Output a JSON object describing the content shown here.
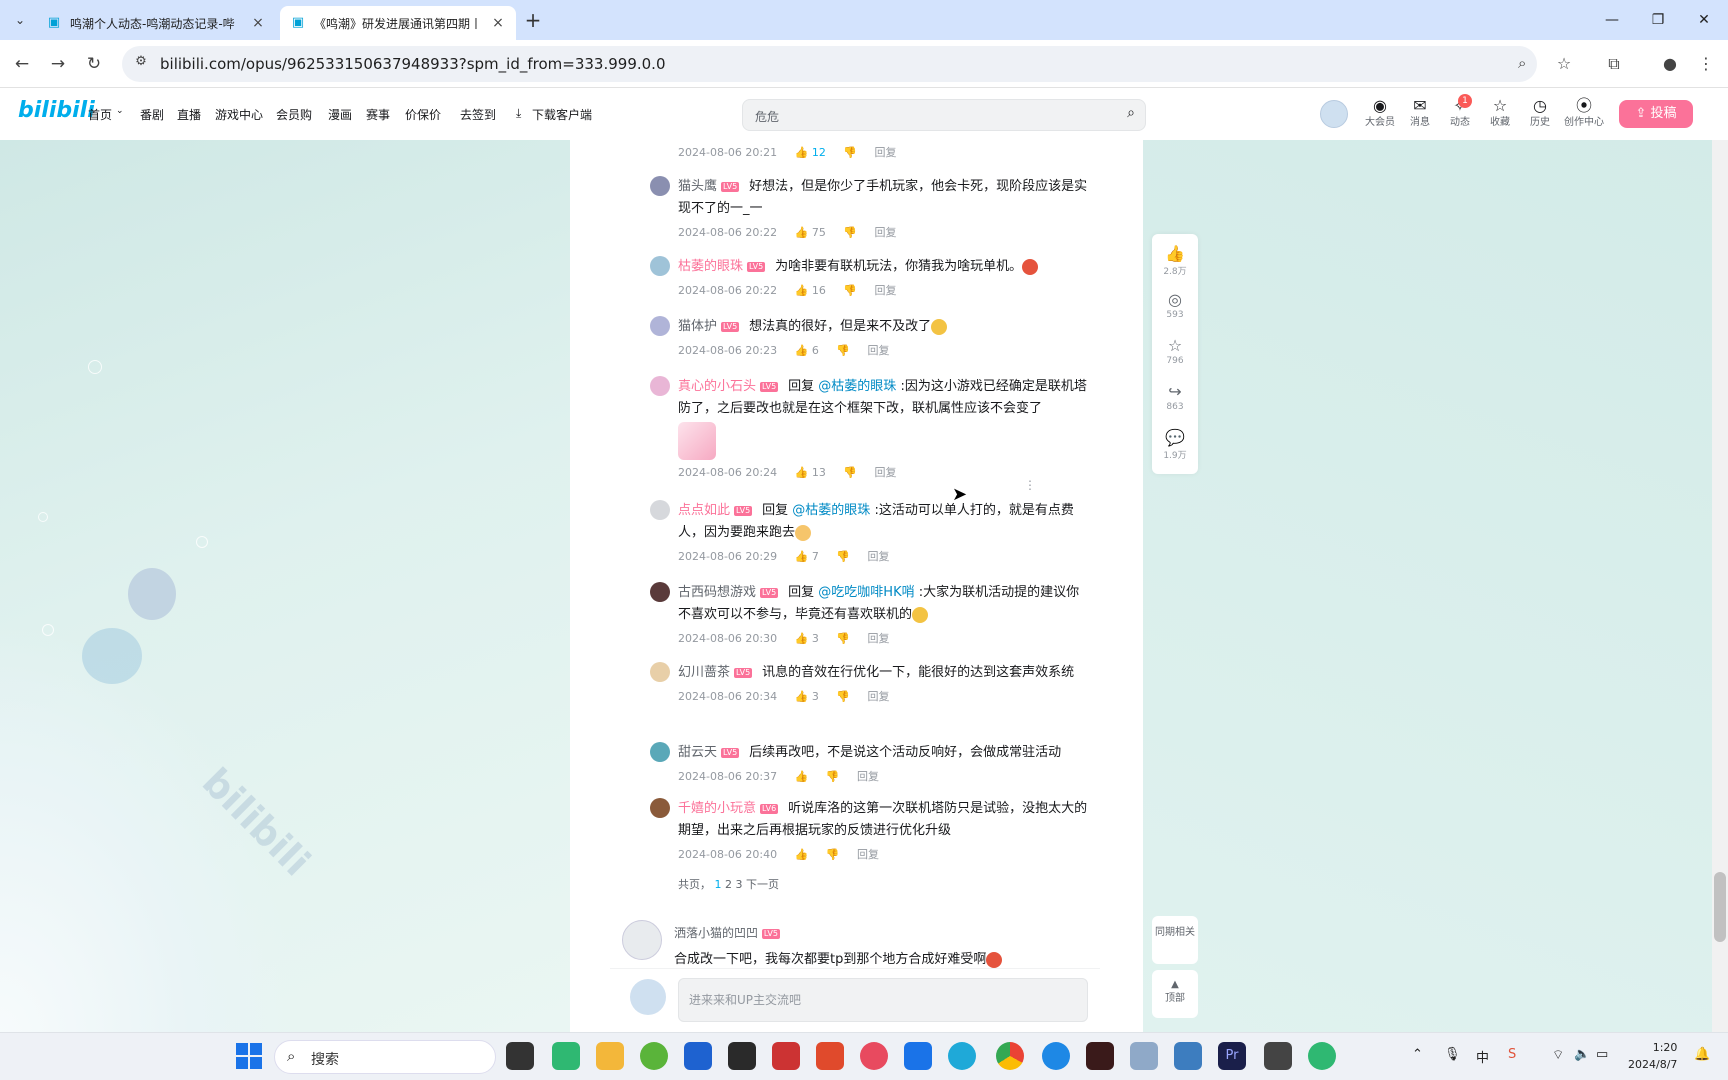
{
  "browser": {
    "tabs": [
      {
        "title": "鸣潮个人动态-鸣潮动态记录-哔"
      },
      {
        "title": "《鸣潮》研发进展通讯第四期丨"
      }
    ],
    "url": "bilibili.com/opus/962533150637948933?spm_id_from=333.999.0.0"
  },
  "header": {
    "logo": "bilibili",
    "nav": [
      "首页",
      "番剧",
      "直播",
      "游戏中心",
      "会员购",
      "漫画",
      "赛事",
      "价保价",
      "去签到",
      "下载客户端"
    ],
    "search_placeholder": "危危",
    "icons": [
      {
        "name": "大会员",
        "glyph": "◉"
      },
      {
        "name": "消息",
        "glyph": "✉"
      },
      {
        "name": "动态",
        "glyph": "✧"
      },
      {
        "name": "收藏",
        "glyph": "☆"
      },
      {
        "name": "历史",
        "glyph": "◷"
      },
      {
        "name": "创作中心",
        "glyph": "⦿"
      }
    ],
    "badge": "1",
    "upload": "投稿"
  },
  "replies": [
    {
      "meta": {
        "date": "2024-08-06 20:21",
        "likes": "12",
        "reply": "回复"
      }
    },
    {
      "user": "猫头鹰",
      "level": "LV5",
      "text": "好想法，但是你少了手机玩家，他会卡死，现阶段应该是实现不了的一_一",
      "meta": {
        "date": "2024-08-06 20:22",
        "likes": "75",
        "reply": "回复"
      }
    },
    {
      "user": "枯萎的眼珠",
      "level": "LV5",
      "pink": true,
      "text": "为啥非要有联机玩法，你猜我为啥玩单机。",
      "meta": {
        "date": "2024-08-06 20:22",
        "likes": "16",
        "reply": "回复"
      }
    },
    {
      "user": "猫体护",
      "level": "LV5",
      "text": "想法真的很好，但是来不及改了",
      "meta": {
        "date": "2024-08-06 20:23",
        "likes": "6",
        "reply": "回复"
      }
    },
    {
      "user": "真心的小石头",
      "level": "LV5",
      "pink": true,
      "prefix": "回复 ",
      "at": "@枯萎的眼珠",
      "text": " :因为这小游戏已经确定是联机塔防了，之后要改也就是在这个框架下改，联机属性应该不会变了",
      "meta": {
        "date": "2024-08-06 20:24",
        "likes": "13",
        "reply": "回复"
      }
    },
    {
      "user": "点点如此",
      "level": "LV5",
      "pink": true,
      "prefix": "回复 ",
      "at": "@枯萎的眼珠",
      "text": " :这活动可以单人打的，就是有点费人，因为要跑来跑去",
      "meta": {
        "date": "2024-08-06 20:29",
        "likes": "7",
        "reply": "回复"
      }
    },
    {
      "user": "古西码想游戏",
      "level": "LV5",
      "prefix": "回复 ",
      "at": "@吃吃咖啡HK哨",
      "text": " :大家为联机活动提的建议你不喜欢可以不参与，毕竟还有喜欢联机的",
      "meta": {
        "date": "2024-08-06 20:30",
        "likes": "3",
        "reply": "回复"
      }
    },
    {
      "user": "幻川蔷茶",
      "level": "LV5",
      "text": "讯息的音效在行优化一下，能很好的达到这套声效系统",
      "meta": {
        "date": "2024-08-06 20:34",
        "likes": "3",
        "reply": "回复"
      }
    },
    {
      "user": "甜云天",
      "level": "LV5",
      "text": "后续再改吧，不是说这个活动反响好，会做成常驻活动",
      "meta": {
        "date": "2024-08-06 20:37",
        "likes": "",
        "reply": "回复"
      }
    },
    {
      "user": "千嬉的小玩意",
      "level": "LV6",
      "pink": true,
      "text": "听说库洛的这第一次联机塔防只是试验，没抱太大的期望，出来之后再根据玩家的反馈进行优化升级",
      "meta": {
        "date": "2024-08-06 20:40",
        "likes": "",
        "reply": "回复"
      }
    }
  ],
  "pager": {
    "prefix": "共页，",
    "pages": [
      "1",
      "2",
      "3"
    ],
    "next": "下一页"
  },
  "top_comment": {
    "user": "洒落小猫的凹凹",
    "level": "LV5",
    "text": "合成改一下吧，我每次都要tp到那个地方合成好难受啊"
  },
  "reply_input_placeholder": "进来来和UP主交流吧",
  "side_actions": [
    {
      "icon": "thumb-up-icon",
      "glyph": "👍",
      "count": "2.8万"
    },
    {
      "icon": "coin-icon",
      "glyph": "◎",
      "count": "593"
    },
    {
      "icon": "star-icon",
      "glyph": "☆",
      "count": "796"
    },
    {
      "icon": "share-icon",
      "glyph": "↪",
      "count": "863"
    },
    {
      "icon": "comment-icon",
      "glyph": "💬",
      "count": "1.9万"
    }
  ],
  "back_btn": "同期相关",
  "top_btn": "顶部",
  "taskbar": {
    "search_label": "搜索",
    "time": "1:20",
    "date": "2024/8/7"
  }
}
